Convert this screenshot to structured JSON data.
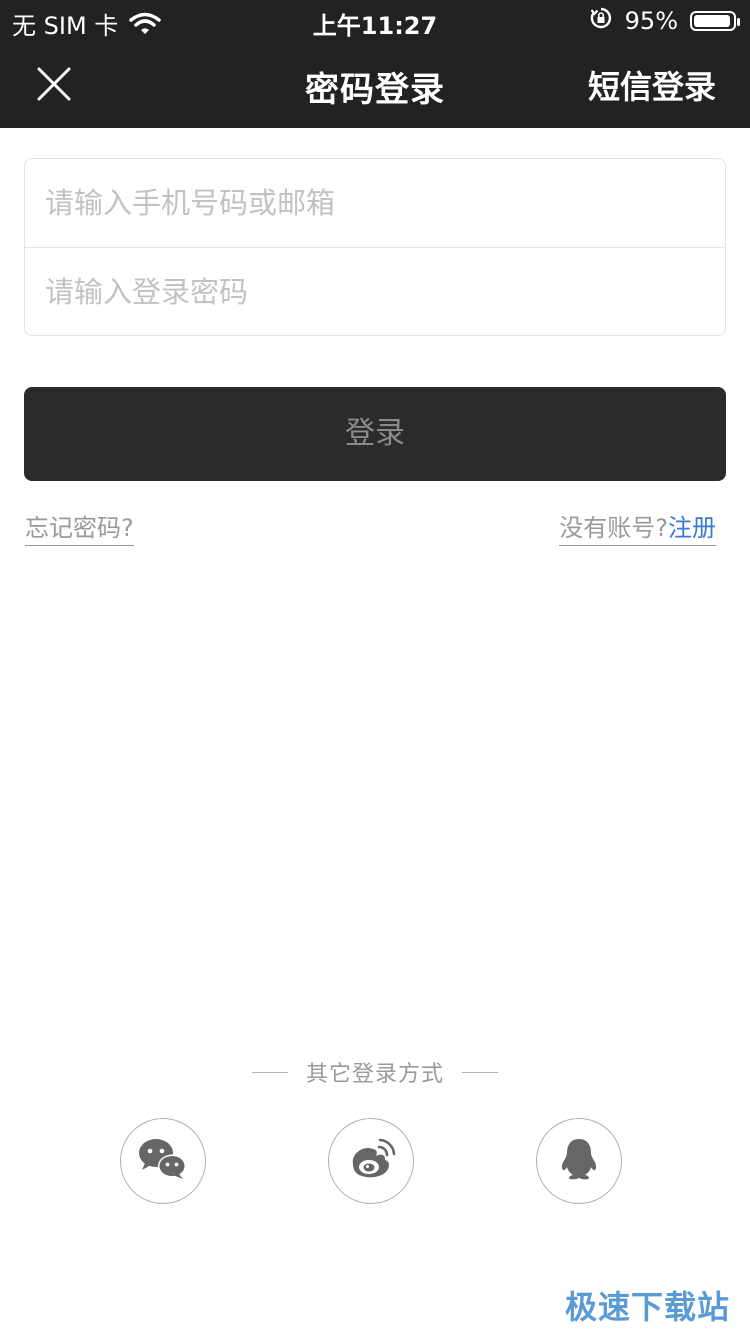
{
  "status_bar": {
    "carrier": "无 SIM 卡",
    "time": "上午11:27",
    "battery": "95%",
    "battery_level": 0.95
  },
  "nav": {
    "title": "密码登录",
    "right_action": "短信登录",
    "close_icon": "close-icon"
  },
  "form": {
    "phone_placeholder": "请输入手机号码或邮箱",
    "password_placeholder": "请输入登录密码",
    "phone_value": "",
    "password_value": ""
  },
  "login_button": "登录",
  "forgot_password": "忘记密码?",
  "register": {
    "prompt": "没有账号?",
    "link": "注册"
  },
  "other_login": {
    "title": "其它登录方式",
    "methods": [
      "wechat-icon",
      "weibo-icon",
      "qq-icon"
    ]
  },
  "watermark": "极速下载站",
  "colors": {
    "header_bg": "#222222",
    "login_button_bg": "#2b2b2b",
    "link_blue": "#3a7bd5",
    "watermark": "#5b9bd5"
  }
}
